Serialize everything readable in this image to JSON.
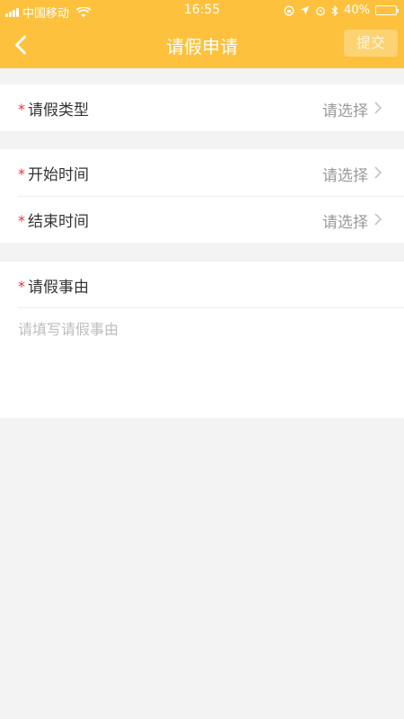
{
  "status_bar": {
    "carrier": "中国移动",
    "time": "16:55",
    "battery_text": "40%",
    "battery_level": 0.4
  },
  "nav": {
    "title": "请假申请",
    "submit_label": "提交",
    "back_icon": "chevron-left-icon"
  },
  "form": {
    "required_mark": "*",
    "leave_type": {
      "label": "请假类型",
      "value": "请选择"
    },
    "start_time": {
      "label": "开始时间",
      "value": "请选择"
    },
    "end_time": {
      "label": "结束时间",
      "value": "请选择"
    },
    "reason": {
      "label": "请假事由",
      "placeholder": "请填写请假事由"
    }
  },
  "colors": {
    "accent": "#fdc13d",
    "required": "#e8323c",
    "background": "#f3f3f3"
  }
}
